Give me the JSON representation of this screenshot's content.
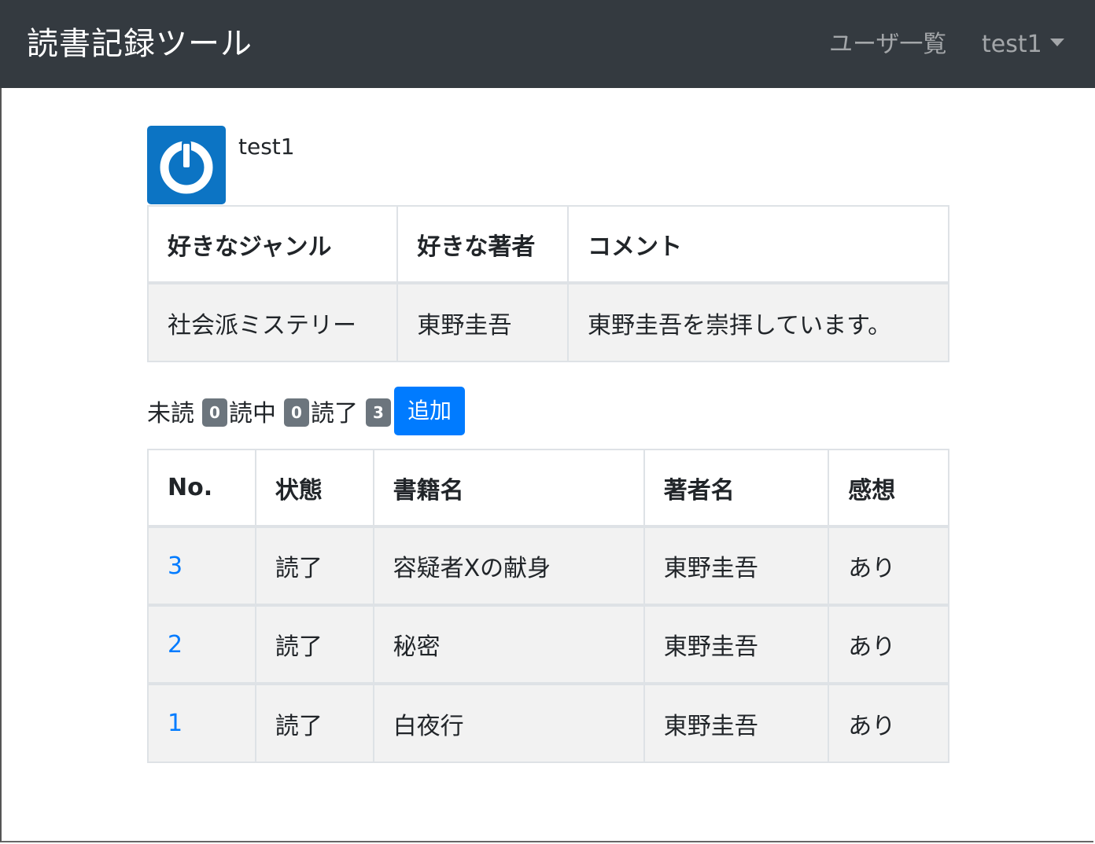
{
  "navbar": {
    "brand": "読書記録ツール",
    "users_link": "ユーザ一覧",
    "current_user": "test1",
    "colors": {
      "background": "#343a40",
      "text": "#ffffff"
    }
  },
  "profile": {
    "avatar_icon": "power-icon",
    "username": "test1",
    "headers": [
      "好きなジャンル",
      "好きな著者",
      "コメント"
    ],
    "values": [
      "社会派ミステリー",
      "東野圭吾",
      "東野圭吾を崇拝しています。"
    ]
  },
  "status_counts": {
    "unread_label": "未読",
    "unread_count": "0",
    "reading_label": "読中",
    "reading_count": "0",
    "finished_label": "読了",
    "finished_count": "3",
    "add_button": "追加"
  },
  "books": {
    "headers": [
      "No.",
      "状態",
      "書籍名",
      "著者名",
      "感想"
    ],
    "rows": [
      {
        "no": "3",
        "status": "読了",
        "title": "容疑者Xの献身",
        "author": "東野圭吾",
        "review": "あり"
      },
      {
        "no": "2",
        "status": "読了",
        "title": "秘密",
        "author": "東野圭吾",
        "review": "あり"
      },
      {
        "no": "1",
        "status": "読了",
        "title": "白夜行",
        "author": "東野圭吾",
        "review": "あり"
      }
    ]
  },
  "colors": {
    "primary": "#007bff",
    "badge": "#6c757d",
    "avatar": "#0c74c4",
    "row_background": "#f2f2f2"
  }
}
